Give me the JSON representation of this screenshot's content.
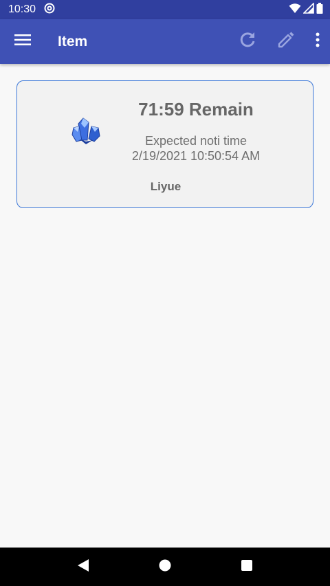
{
  "status_bar": {
    "time": "10:30",
    "icons": [
      "at-sign-icon",
      "wifi-icon",
      "signal-icon",
      "battery-icon"
    ]
  },
  "app_bar": {
    "title": "Item",
    "icons": [
      "menu-icon",
      "refresh-icon",
      "edit-icon",
      "more-vert-icon"
    ]
  },
  "card": {
    "remain": "71:59 Remain",
    "expected_label": "Expected noti time",
    "expected_time": "2/19/2021 10:50:54 AM",
    "region": "Liyue",
    "icon": "crystal-icon"
  },
  "nav_bar": {
    "icons": [
      "back-icon",
      "home-icon",
      "recents-icon"
    ]
  },
  "colors": {
    "status_bar": "#303f9f",
    "app_bar": "#3f51b5",
    "card_border": "#3a76d8",
    "card_background": "#f2f2f2",
    "page_background": "#f8f8f8"
  }
}
